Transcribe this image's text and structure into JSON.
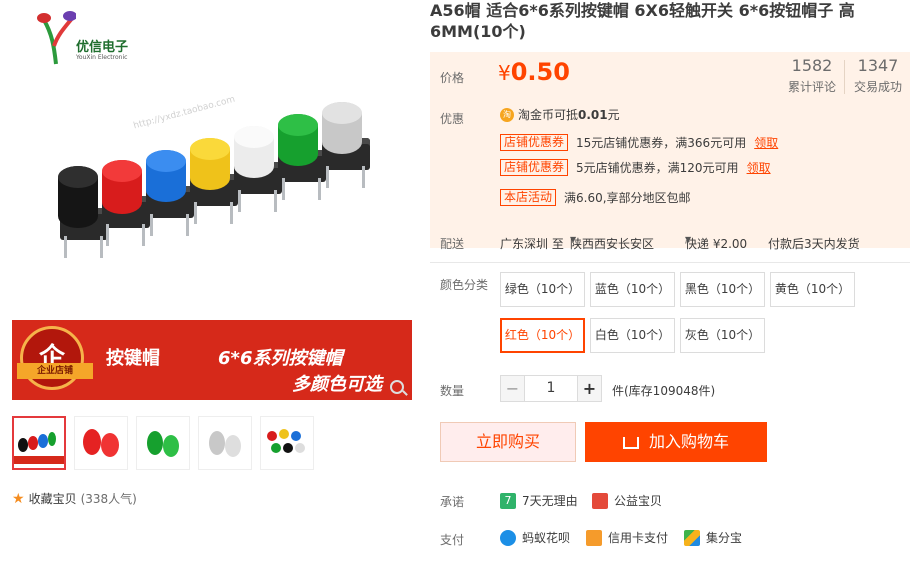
{
  "logo": {
    "brand": "优信电子",
    "brand_en": "YouXin Electronic"
  },
  "banner": {
    "badge_glyph": "企",
    "badge_label": "企业店铺",
    "title_left": "按键帽",
    "title_right": "6*6系列按键帽",
    "subtitle": "多颜色可选"
  },
  "watermark": "http://yxdz.taobao.com",
  "favorite": {
    "label": "收藏宝贝",
    "count": "(338人气)"
  },
  "product": {
    "title": "A56帽 适合6*6系列按键帽 6X6轻触开关 6*6按钮帽子 高6MM(10个)"
  },
  "price": {
    "label": "价格",
    "currency": "¥",
    "value": "0.50",
    "reviews_num": "1582",
    "reviews_label": "累计评论",
    "sales_num": "1347",
    "sales_label": "交易成功"
  },
  "promo": {
    "label": "优惠",
    "coin_icon": "淘",
    "coin_prefix": "淘金币可抵",
    "coin_amount": "0.01",
    "coin_suffix": "元",
    "coupons": [
      {
        "tag": "店铺优惠券",
        "text": "15元店铺优惠券，满366元可用",
        "link": "领取"
      },
      {
        "tag": "店铺优惠券",
        "text": "5元店铺优惠券，满120元可用",
        "link": "领取"
      }
    ],
    "activity_tag": "本店活动",
    "activity_text": "满6.60,享部分地区包邮"
  },
  "delivery": {
    "label": "配送",
    "from": "广东深圳 至",
    "to": "陕西西安长安区",
    "method": "快递 ¥2.00",
    "ship": "付款后3天内发货"
  },
  "sku": {
    "label": "颜色分类",
    "options": [
      "绿色（10个）",
      "蓝色（10个）",
      "黑色（10个）",
      "黄色（10个）",
      "红色（10个）",
      "白色（10个）",
      "灰色（10个）"
    ],
    "selected": "红色（10个）"
  },
  "quantity": {
    "label": "数量",
    "minus": "−",
    "value": "1",
    "plus": "+",
    "stock": "件(库存109048件)"
  },
  "actions": {
    "buy": "立即购买",
    "cart": "加入购物车"
  },
  "promise": {
    "label": "承诺",
    "items": [
      "7天无理由",
      "公益宝贝"
    ]
  },
  "payment": {
    "label": "支付",
    "items": [
      "蚂蚁花呗",
      "信用卡支付",
      "集分宝"
    ]
  },
  "colors": {
    "accent": "#ff4400",
    "panel_bg": "#fff2e8",
    "banner_red": "#d6291a"
  }
}
